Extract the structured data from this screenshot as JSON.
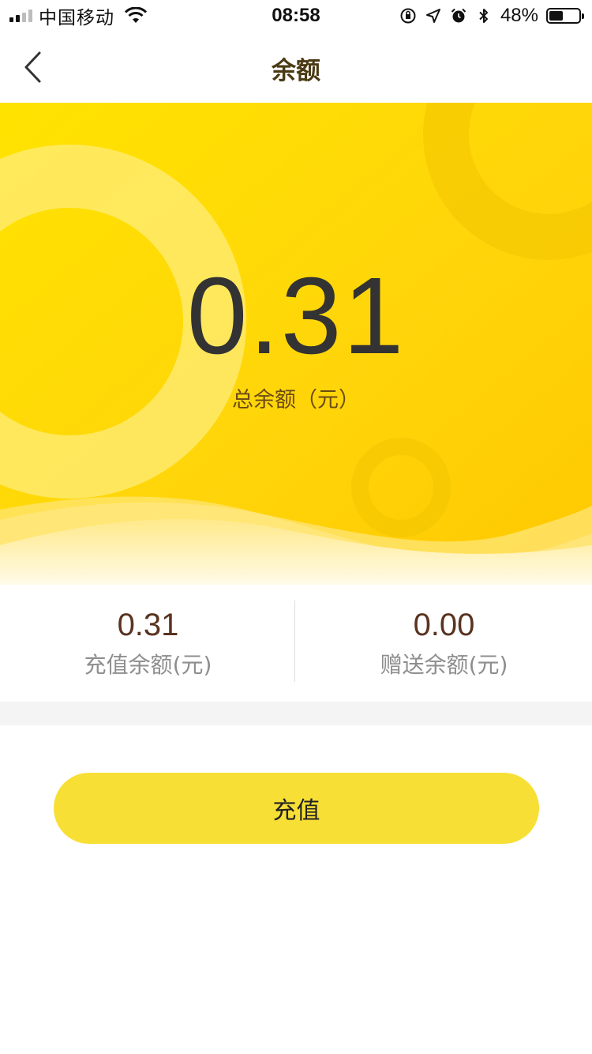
{
  "status_bar": {
    "carrier": "中国移动",
    "time": "08:58",
    "battery_percent": "48%",
    "battery_level": 0.48,
    "icons": [
      "signal-icon",
      "wifi-icon",
      "orientation-lock-icon",
      "location-icon",
      "alarm-icon",
      "bluetooth-icon",
      "battery-icon"
    ]
  },
  "nav": {
    "title": "余额",
    "back_icon": "chevron-left-icon"
  },
  "hero": {
    "total_amount": "0.31",
    "total_label": "总余额（元）"
  },
  "balances": [
    {
      "amount": "0.31",
      "label": "充值余额(元)"
    },
    {
      "amount": "0.00",
      "label": "赠送余额(元)"
    }
  ],
  "actions": {
    "recharge_label": "充值"
  },
  "colors": {
    "hero_yellow": "#ffd21a",
    "button_yellow": "#f8df35",
    "amount_dark": "#333333",
    "sub_amount": "#5a3320",
    "label_gray": "#8e8e8e"
  }
}
